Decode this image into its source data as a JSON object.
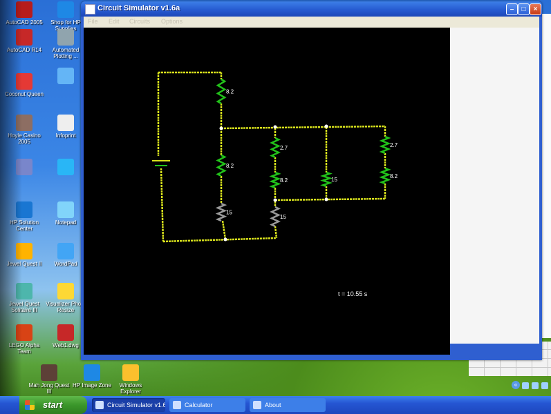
{
  "desktop": {
    "icons": [
      {
        "label": "AutoCAD 2005",
        "icon": "autocad-icon",
        "color": "#b71c1c"
      },
      {
        "label": "Shop for HP Supplies",
        "icon": "shopping-icon",
        "color": "#1e88e5"
      },
      {
        "label": "AutoCAD R14",
        "icon": "autocad-r14-icon",
        "color": "#c62828"
      },
      {
        "label": "Automated Plotting ...",
        "icon": "plotter-icon",
        "color": "#90a4ae"
      },
      {
        "label": "Coconut Queen",
        "icon": "game-icon",
        "color": "#e53935"
      },
      {
        "label": "",
        "icon": "program-icon",
        "color": "#64b5f6"
      },
      {
        "label": "Hoyle Casino 2005",
        "icon": "casino-icon",
        "color": "#8d6e63"
      },
      {
        "label": "Infoprint",
        "icon": "document-icon",
        "color": "#eeeeee"
      },
      {
        "label": "",
        "icon": "program-icon",
        "color": "#7986cb"
      },
      {
        "label": "",
        "icon": "internet-explorer-icon",
        "color": "#29b6f6"
      },
      {
        "label": "HP Solution Center",
        "icon": "hp-icon",
        "color": "#1976d2"
      },
      {
        "label": "Notepad",
        "icon": "notepad-icon",
        "color": "#81d4fa"
      },
      {
        "label": "Jewel Quest II",
        "icon": "jewel-icon",
        "color": "#ffb300"
      },
      {
        "label": "WordPad",
        "icon": "wordpad-icon",
        "color": "#42a5f5"
      },
      {
        "label": "Jewel Quest Solitaire III",
        "icon": "cards-icon",
        "color": "#4db6ac"
      },
      {
        "label": "Visualizer Photo Resize",
        "icon": "photo-icon",
        "color": "#fdd835"
      },
      {
        "label": "LEGO Alpha Team",
        "icon": "lego-icon",
        "color": "#d84315"
      },
      {
        "label": "Web1.dwg",
        "icon": "drawing-file-icon",
        "color": "#c62828"
      },
      {
        "label": "Mah Jong Quest III",
        "icon": "mahjong-icon",
        "color": "#5d4037"
      },
      {
        "label": "HP Image Zone",
        "icon": "image-zone-icon",
        "color": "#1e88e5"
      },
      {
        "label": "Windows Explorer",
        "icon": "folder-icon",
        "color": "#fbc02d"
      }
    ]
  },
  "window": {
    "title": "Circuit Simulator v1.6a",
    "menu": [
      "File",
      "Edit",
      "Circuits",
      "Options"
    ],
    "time_readout": "t = 10.55 s"
  },
  "circuit": {
    "wire_color": "#d8e21c",
    "resistor_color": "#22c21a",
    "labels": {
      "r_top": "8.2",
      "r_mid": "8.2",
      "r_low": "15",
      "r_a1": "2.7",
      "r_a2": "8.2",
      "r_a3": "15",
      "r_b": "15",
      "r_c1": "2.7",
      "r_c2": "8.2"
    }
  },
  "taskbar": {
    "start_label": "start",
    "tasks": [
      {
        "label": "Circuit Simulator v1.6a",
        "active": true
      },
      {
        "label": "Calculator",
        "active": false
      },
      {
        "label": "About",
        "active": false
      }
    ]
  }
}
